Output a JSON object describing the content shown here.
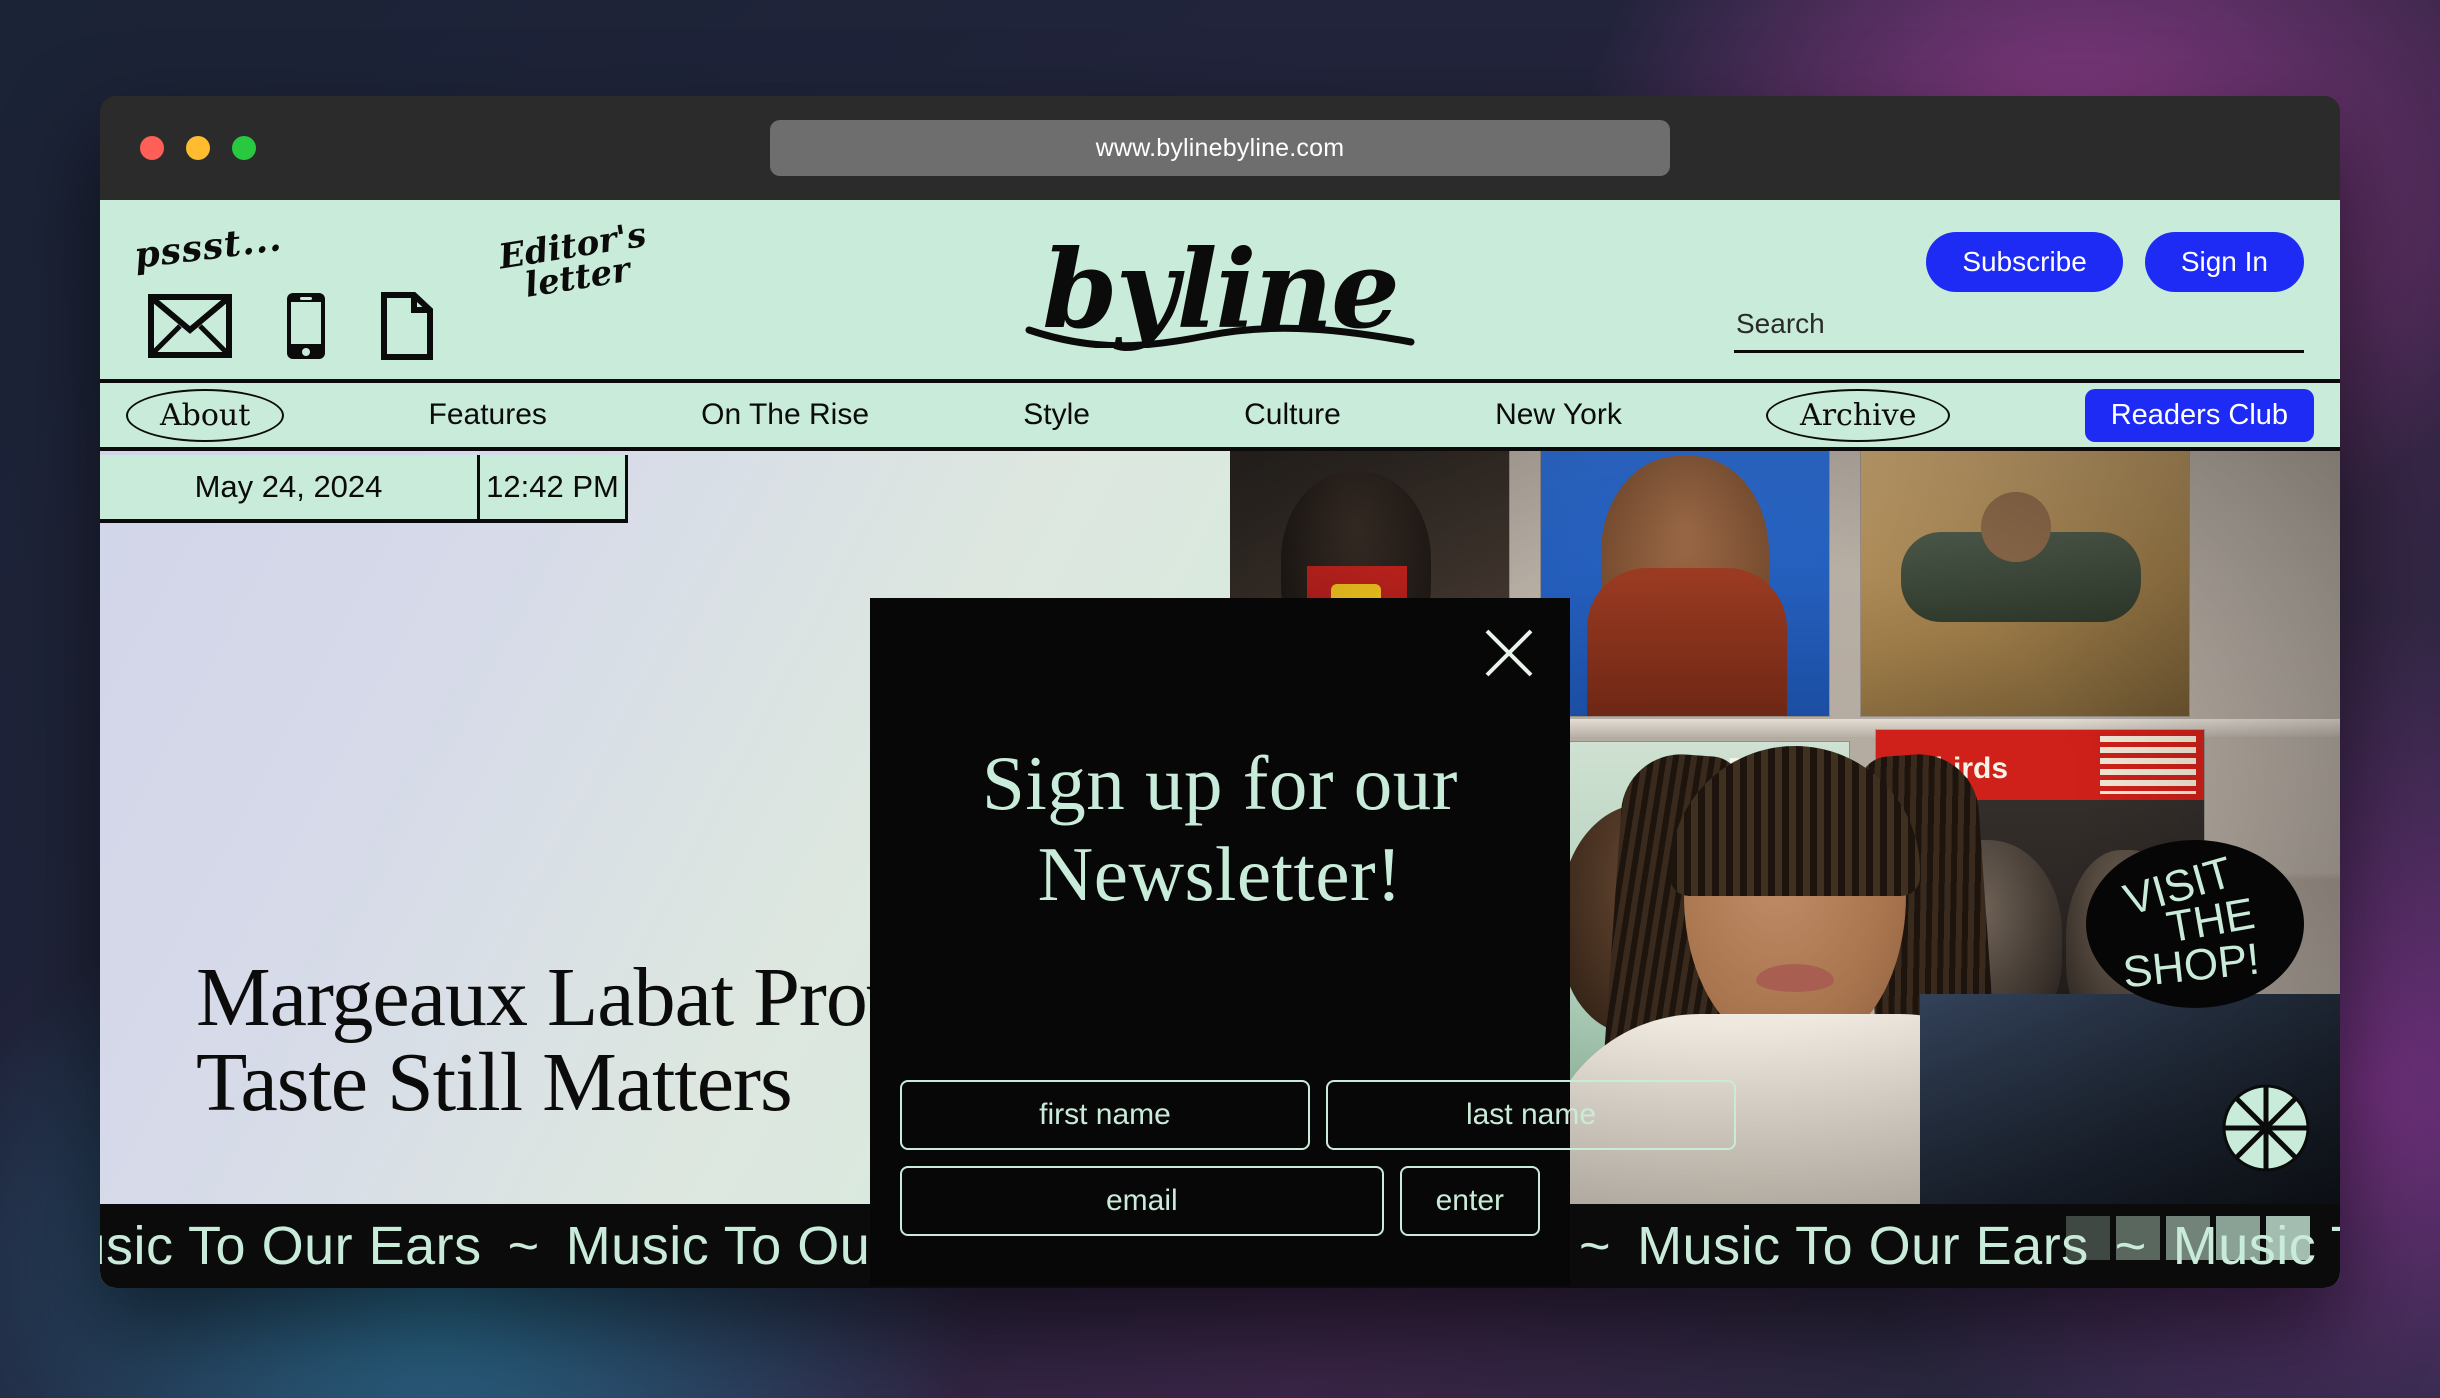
{
  "browser": {
    "url": "www.bylinebyline.com",
    "traffic_lights": [
      "close-red",
      "minimize-yellow",
      "maximize-green"
    ]
  },
  "masthead": {
    "promo_label_left": "pssst...",
    "promo_label_right_line1": "Editor's",
    "promo_label_right_line2": "letter",
    "promo_icons": [
      "envelope-icon",
      "mobile-phone-icon",
      "document-icon"
    ],
    "logo": "byline",
    "subscribe_label": "Subscribe",
    "signin_label": "Sign In",
    "search_placeholder": "Search",
    "search_value": ""
  },
  "nav": {
    "items": [
      {
        "label": "About",
        "style": "oval"
      },
      {
        "label": "Features",
        "style": "plain"
      },
      {
        "label": "On The Rise",
        "style": "plain"
      },
      {
        "label": "Style",
        "style": "plain"
      },
      {
        "label": "Culture",
        "style": "plain"
      },
      {
        "label": "New York",
        "style": "plain"
      },
      {
        "label": "Archive",
        "style": "oval"
      },
      {
        "label": "Readers Club",
        "style": "button"
      }
    ]
  },
  "datebar": {
    "date": "May 24, 2024",
    "time": "12:42 PM"
  },
  "hero": {
    "headline_line1": "Margeaux Labat Proves",
    "headline_line2": "Taste Still Matters",
    "shop_badge_line1": "VISIT",
    "shop_badge_line2": "THE",
    "shop_badge_line3": "SHOP!",
    "pie_icon": "eight-spoke-circle-icon"
  },
  "ticker": {
    "item": "Music To Our Ears",
    "separator": "~",
    "repeat": 6,
    "loading_blocks": 5
  },
  "modal": {
    "close_icon": "close-x-icon",
    "title_line1": "Sign up for our",
    "title_line2": "Newsletter!",
    "first_name_placeholder": "first name",
    "first_name_value": "",
    "last_name_placeholder": "last name",
    "last_name_value": "",
    "email_placeholder": "email",
    "email_value": "",
    "enter_label": "enter"
  },
  "colors": {
    "mint": "#c9ebd9",
    "ink": "#0b0b0b",
    "brand_blue": "#1d2bf5",
    "modal_bg": "#070707",
    "hero_gradient_start": "#d2d5e9",
    "hero_gradient_end": "#d6ecdb"
  }
}
